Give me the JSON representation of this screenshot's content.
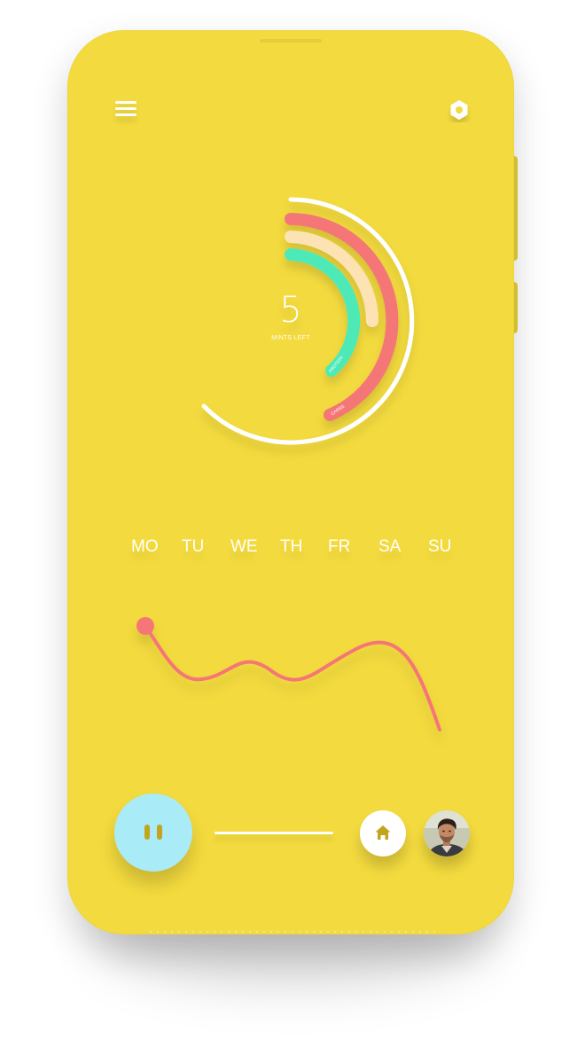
{
  "app": {
    "background_color": "#f3da3e",
    "accent_colors": {
      "outer_ring": "#ffffff",
      "coral": "#f57676",
      "peach": "#fde2b3",
      "mint": "#4eeab8",
      "play_button": "#a9ebf6"
    }
  },
  "header": {
    "menu_icon": "hamburger-menu-icon",
    "settings_icon": "hexagon-gear-icon"
  },
  "gauge": {
    "value": "5",
    "caption": "MINTS LEFT",
    "rings": [
      {
        "name": "outer",
        "color": "#ffffff"
      },
      {
        "name": "coral",
        "color": "#f57676",
        "label": "CARBS"
      },
      {
        "name": "peach",
        "color": "#fde2b3"
      },
      {
        "name": "mint",
        "color": "#4eeab8",
        "label": "PROTEIN"
      }
    ]
  },
  "days": {
    "items": [
      "MO",
      "TU",
      "WE",
      "TH",
      "FR",
      "SA",
      "SU"
    ]
  },
  "trend": {
    "line_color": "#f57676"
  },
  "controls": {
    "pause_icon": "pause-icon",
    "home_icon": "home-icon",
    "avatar_icon": "user-avatar"
  }
}
